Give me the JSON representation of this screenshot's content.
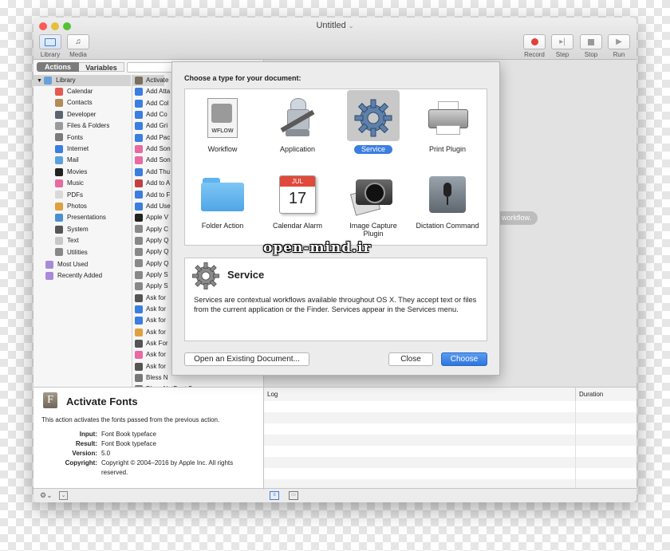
{
  "window": {
    "title": "Untitled"
  },
  "toolbar": {
    "library_label": "Library",
    "media_label": "Media",
    "record_label": "Record",
    "step_label": "Step",
    "stop_label": "Stop",
    "run_label": "Run"
  },
  "tabs": {
    "actions": "Actions",
    "variables": "Variables"
  },
  "library": {
    "root": "Library",
    "items": [
      "Calendar",
      "Contacts",
      "Developer",
      "Files & Folders",
      "Fonts",
      "Internet",
      "Mail",
      "Movies",
      "Music",
      "PDFs",
      "Photos",
      "Presentations",
      "System",
      "Text",
      "Utilities"
    ],
    "extra": [
      "Most Used",
      "Recently Added"
    ]
  },
  "actions": {
    "items": [
      "Activate",
      "Add Atta",
      "Add Col",
      "Add Co",
      "Add Gri",
      "Add Pac",
      "Add Son",
      "Add Son",
      "Add Thu",
      "Add to A",
      "Add to F",
      "Add Use",
      "Apple V",
      "Apply C",
      "Apply Q",
      "Apply Q",
      "Apply Q",
      "Apply S",
      "Apply S",
      "Ask for",
      "Ask for",
      "Ask for",
      "Ask for",
      "Ask For",
      "Ask for",
      "Ask for",
      "Bless N",
      "Bless NetBoot Server"
    ]
  },
  "description": {
    "title": "Activate Fonts",
    "summary": "This action activates the fonts passed from the previous action.",
    "input_label": "Input:",
    "input_value": "Font Book typeface",
    "result_label": "Result:",
    "result_value": "Font Book typeface",
    "version_label": "Version:",
    "version_value": "5.0",
    "copyright_label": "Copyright:",
    "copyright_value": "Copyright © 2004–2016 by Apple Inc. All rights reserved."
  },
  "sheet": {
    "prompt": "Choose a type for your document:",
    "types": [
      "Workflow",
      "Application",
      "Service",
      "Print Plugin",
      "Folder Action",
      "Calendar Alarm",
      "Image Capture Plugin",
      "Dictation Command"
    ],
    "workflow_badge": "WFLOW",
    "calendar_month": "JUL",
    "calendar_day": "17",
    "service_title": "Service",
    "service_desc": "Services are contextual workflows available throughout OS X. They accept text or files from the current application or the Finder. Services appear in the Services menu.",
    "open_existing": "Open an Existing Document...",
    "close": "Close",
    "choose": "Choose"
  },
  "workflow_hint": "workflow.",
  "watermark": "open-mind.ir",
  "log": {
    "log_header": "Log",
    "duration_header": "Duration"
  },
  "colors": {
    "accent": "#3b7ee0",
    "close": "#fc5b57",
    "minimize": "#e5bf3c",
    "zoom": "#57c038"
  }
}
